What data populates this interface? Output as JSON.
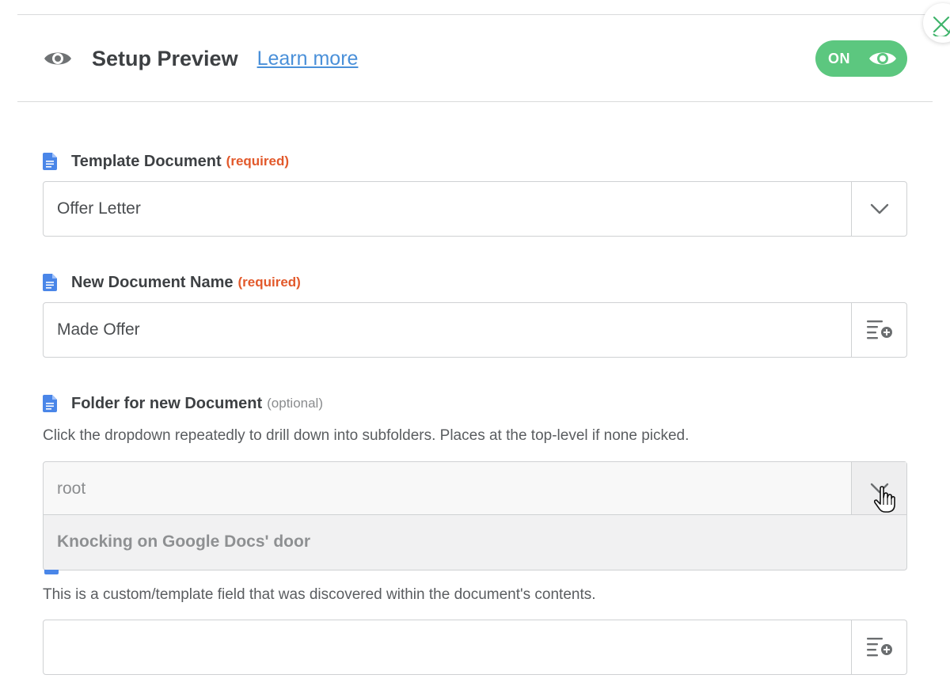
{
  "header": {
    "title": "Setup Preview",
    "learn_more": "Learn more",
    "toggle_label": "ON"
  },
  "fields": {
    "template": {
      "label": "Template Document",
      "tag": "(required)",
      "value": "Offer Letter"
    },
    "new_name": {
      "label": "New Document Name",
      "tag": "(required)",
      "value": "Made Offer"
    },
    "folder": {
      "label": "Folder for new Document",
      "tag": "(optional)",
      "help": "Click the dropdown repeatedly to drill down into subfolders. Places at the top-level if none picked.",
      "value": "root",
      "dropdown_message": "Knocking on Google Docs' door"
    },
    "custom": {
      "help": "This is a custom/template field that was discovered within the document's contents.",
      "value": ""
    }
  },
  "colors": {
    "toggle_on": "#5cc77f",
    "required": "#e2592b",
    "link": "#4a90d9",
    "doc_icon": "#4a86e8"
  },
  "icons": [
    "eye-icon",
    "doc-icon",
    "chevron-down-icon",
    "insert-field-icon",
    "pointer-cursor-icon",
    "close-icon"
  ]
}
